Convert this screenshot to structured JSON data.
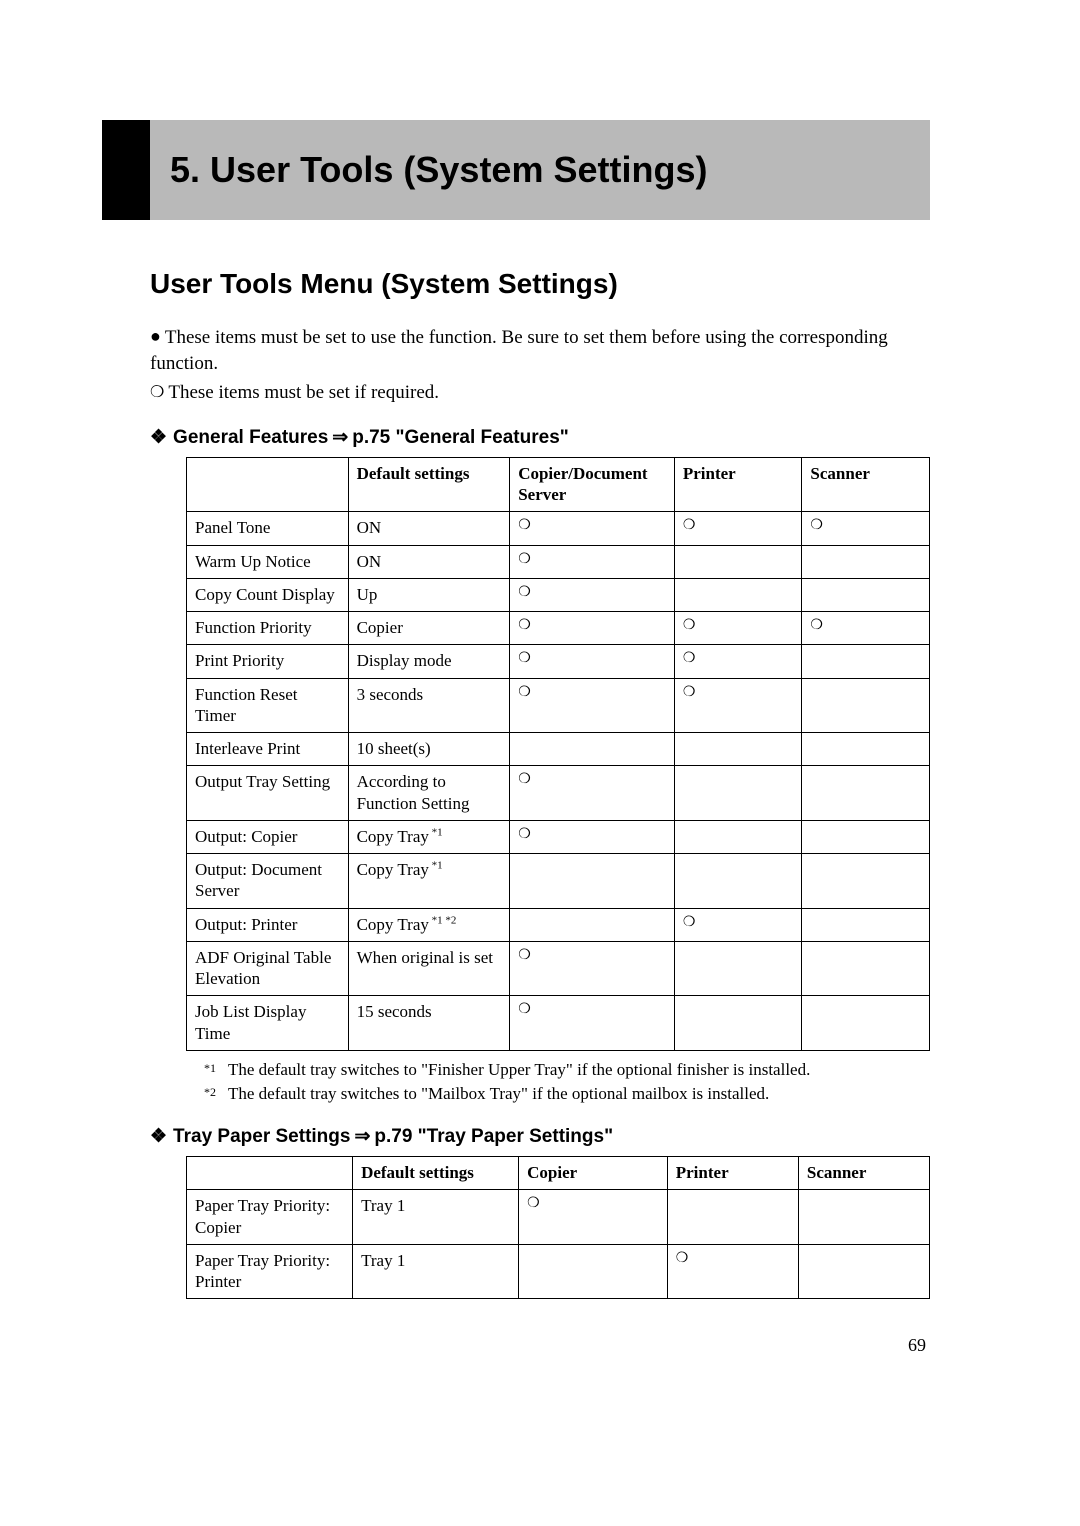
{
  "chapter_title": "5. User Tools (System Settings)",
  "section_title": "User Tools Menu (System Settings)",
  "intro_solid": "These items must be set to use the function. Be sure to set them before using the corresponding function.",
  "intro_hollow": "These items must be set if required.",
  "sub1": {
    "prefix": "General Features",
    "ref": "p.75 \"General Features\"",
    "headers": [
      "",
      "Default settings",
      "Copier/Document Server",
      "Printer",
      "Scanner"
    ],
    "rows": [
      {
        "name": "Panel Tone",
        "def": "ON",
        "c1": "❍",
        "c2": "❍",
        "c3": "❍"
      },
      {
        "name": "Warm Up Notice",
        "def": "ON",
        "c1": "❍",
        "c2": "",
        "c3": ""
      },
      {
        "name": "Copy Count Display",
        "def": "Up",
        "c1": "❍",
        "c2": "",
        "c3": ""
      },
      {
        "name": "Function Priority",
        "def": "Copier",
        "c1": "❍",
        "c2": "❍",
        "c3": "❍"
      },
      {
        "name": "Print Priority",
        "def": "Display mode",
        "c1": "❍",
        "c2": "❍",
        "c3": ""
      },
      {
        "name": "Function Reset Timer",
        "def": "3 seconds",
        "c1": "❍",
        "c2": "❍",
        "c3": ""
      },
      {
        "name": "Interleave Print",
        "def": "10 sheet(s)",
        "c1": "",
        "c2": "",
        "c3": ""
      },
      {
        "name": "Output Tray Setting",
        "def": "According to Function Setting",
        "c1": "❍",
        "c2": "",
        "c3": ""
      },
      {
        "name": "Output: Copier",
        "def": "Copy Tray",
        "def_sup": "*1",
        "c1": "❍",
        "c2": "",
        "c3": ""
      },
      {
        "name": "Output: Document Server",
        "def": "Copy Tray",
        "def_sup": "*1",
        "c1": "",
        "c2": "",
        "c3": ""
      },
      {
        "name": "Output: Printer",
        "def": "Copy Tray",
        "def_sup": "*1 *2",
        "c1": "",
        "c2": "❍",
        "c3": ""
      },
      {
        "name": "ADF Original Table Elevation",
        "def": "When original is set",
        "c1": "❍",
        "c2": "",
        "c3": ""
      },
      {
        "name": "Job List Display Time",
        "def": "15 seconds",
        "c1": "❍",
        "c2": "",
        "c3": ""
      }
    ],
    "footnotes": [
      {
        "num": "*1",
        "text": "The default tray switches to \"Finisher Upper Tray\" if the optional finisher is installed."
      },
      {
        "num": "*2",
        "text": "The default tray switches to \"Mailbox Tray\" if the optional mailbox is installed."
      }
    ]
  },
  "sub2": {
    "prefix": "Tray Paper Settings",
    "ref": "p.79 \"Tray Paper Settings\"",
    "headers": [
      "",
      "Default settings",
      "Copier",
      "Printer",
      "Scanner"
    ],
    "rows": [
      {
        "name": "Paper Tray Priority: Copier",
        "def": "Tray 1",
        "c1": "❍",
        "c2": "",
        "c3": ""
      },
      {
        "name": "Paper Tray Priority: Printer",
        "def": "Tray 1",
        "c1": "",
        "c2": "❍",
        "c3": ""
      }
    ]
  },
  "page_number": "69"
}
